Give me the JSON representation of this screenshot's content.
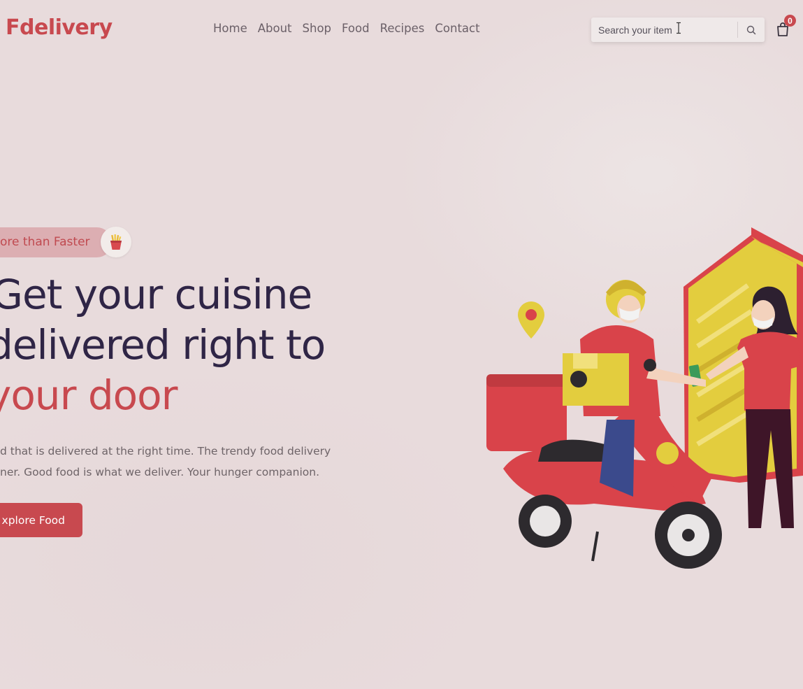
{
  "header": {
    "logo": "Fdelivery",
    "nav": [
      "Home",
      "About",
      "Shop",
      "Food",
      "Recipes",
      "Contact"
    ],
    "search": {
      "placeholder": "Search your item"
    },
    "cart": {
      "count": "0"
    }
  },
  "hero": {
    "tag": "ore than Faster",
    "headline": [
      "Get your cuisine",
      "delivered right to",
      "your door"
    ],
    "description": [
      "d that is delivered at the right time. The trendy food delivery",
      "ner. Good food is what we deliver. Your hunger companion."
    ],
    "cta": "xplore Food"
  },
  "colors": {
    "accent": "#c8494f",
    "heading": "#2f2546",
    "background": "#e8dbdc",
    "illustration_yellow": "#e3cd3e"
  },
  "icons": [
    "search-icon",
    "shopping-bag-icon",
    "fries-icon",
    "text-cursor-icon",
    "location-pin-icon"
  ]
}
